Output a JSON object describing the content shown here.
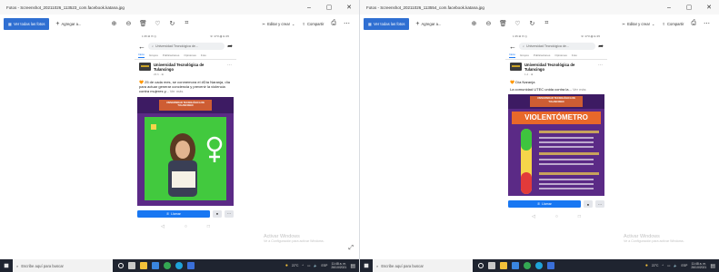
{
  "windows": [
    {
      "title": "Fotos - Screenshot_20211026_113523_com.facebook.katana.jpg",
      "toolbar": {
        "view_all": "Ver todas las fotos",
        "add": "Agregar a...",
        "edit_create": "Editar y crear",
        "share": "Compartir"
      },
      "phone": {
        "status_left": "1:35 ₪ ✉ ◎",
        "status_right": "☏ 47% ▮ 11:35",
        "search": "Universidad Tecnológica de...",
        "tabs": [
          "Inicio",
          "Grupos",
          "Publicaciones",
          "Opiniones",
          "Foto"
        ],
        "page_name": "Universidad Tecnológica de Tulancingo",
        "meta": "23 h · ⊕",
        "text": "🧡 25 de cada mes, se conmemora el #Día Naranja, día para actuar generar conciencia y prevenir la violencia contra mujeres y...",
        "more": "Ver más",
        "banner": "UNIVERSIDAD TECNOLÓGICA DE TULANCINGO",
        "call": "Llamar"
      },
      "activate": {
        "title": "Activar Windows",
        "sub": "Ve a Configuración para activar Windows."
      }
    },
    {
      "title": "Fotos - Screenshot_20211026_113554_com.facebook.katana.jpg",
      "toolbar": {
        "view_all": "Ver todas las fotos",
        "add": "Agregar a...",
        "edit_create": "Editar y crear",
        "share": "Compartir"
      },
      "phone": {
        "status_left": "1:35 ₪ ✉ ◎",
        "status_right": "☏ 47% ▮ 11:35",
        "search": "Universidad Tecnológica de...",
        "tabs": [
          "Inicio",
          "Grupos",
          "Publicaciones",
          "Opiniones",
          "Foto"
        ],
        "page_name": "Universidad Tecnológica de Tulancingo",
        "meta": "1 d · ⊕",
        "text": "🧡 Día Naranja",
        "text2": "La comunidad UTEC unida contra la...",
        "more": "Ver más",
        "banner": "UNIVERSIDAD TECNOLÓGICA DE TULANCINGO",
        "headline": "VIOLENTÓMETRO",
        "call": "Llamar"
      },
      "activate": {
        "title": "Activar Windows",
        "sub": "Ve a Configuración para activar Windows."
      }
    }
  ],
  "taskbar": {
    "search_placeholder": "Escribe aquí para buscar",
    "weather": "22°C",
    "lang": "ESP",
    "time": "11:48 a. m.",
    "date": "26/10/2021"
  },
  "colors": {
    "accent": "#2f6fd2",
    "fb_blue": "#1877f2",
    "orange": "#e8682a",
    "purple": "#5b2a86",
    "green": "#3ec43e"
  }
}
